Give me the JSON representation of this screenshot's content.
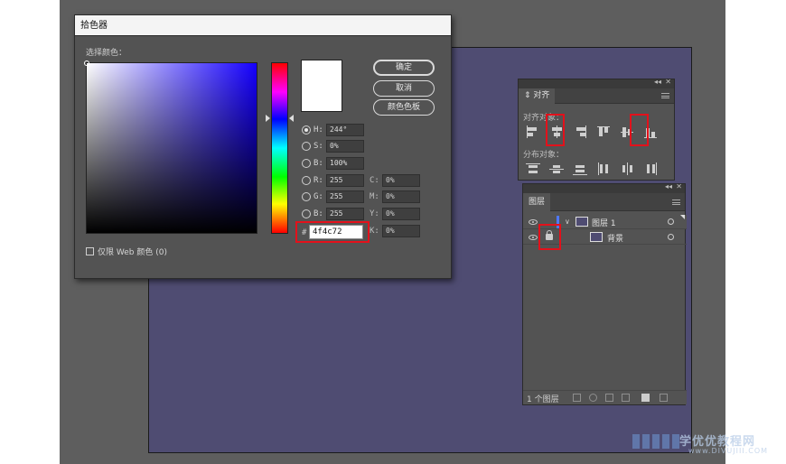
{
  "picker": {
    "title": "拾色器",
    "select_color_label": "选择颜色：",
    "buttons": {
      "ok": "确定",
      "cancel": "取消",
      "swatches": "颜色色板"
    },
    "fields": {
      "H": {
        "key": "H:",
        "value": "244°",
        "selected": true
      },
      "S": {
        "key": "S:",
        "value": "0%"
      },
      "B": {
        "key": "B:",
        "value": "100%"
      },
      "R": {
        "key": "R:",
        "value": "255"
      },
      "G": {
        "key": "G:",
        "value": "255"
      },
      "Bl": {
        "key": "B:",
        "value": "255"
      }
    },
    "cmyk": {
      "C": {
        "key": "C:",
        "value": "0%"
      },
      "M": {
        "key": "M:",
        "value": "0%"
      },
      "Y": {
        "key": "Y:",
        "value": "0%"
      },
      "K": {
        "key": "K:",
        "value": "0%"
      }
    },
    "hex_key": "#",
    "hex_value": "4f4c72",
    "web_only_label": "仅限 Web 颜色 (0)",
    "new_color": "#ffffff",
    "field_hue_color": "#1500ff"
  },
  "align_panel": {
    "tab": "对齐",
    "tab_icon": "⇕",
    "align_objects_label": "对齐对象：",
    "distribute_objects_label": "分布对象："
  },
  "layers_panel": {
    "tab": "图层",
    "layers": [
      {
        "name": "图层 1"
      },
      {
        "name": "背景"
      }
    ],
    "count_label": "1 个图层"
  },
  "artboard_color": "#4f4c72",
  "highlight_color": "#e3111b",
  "watermark": {
    "name": "学优优教程网",
    "url": "www.DIVUJIII.COM"
  }
}
